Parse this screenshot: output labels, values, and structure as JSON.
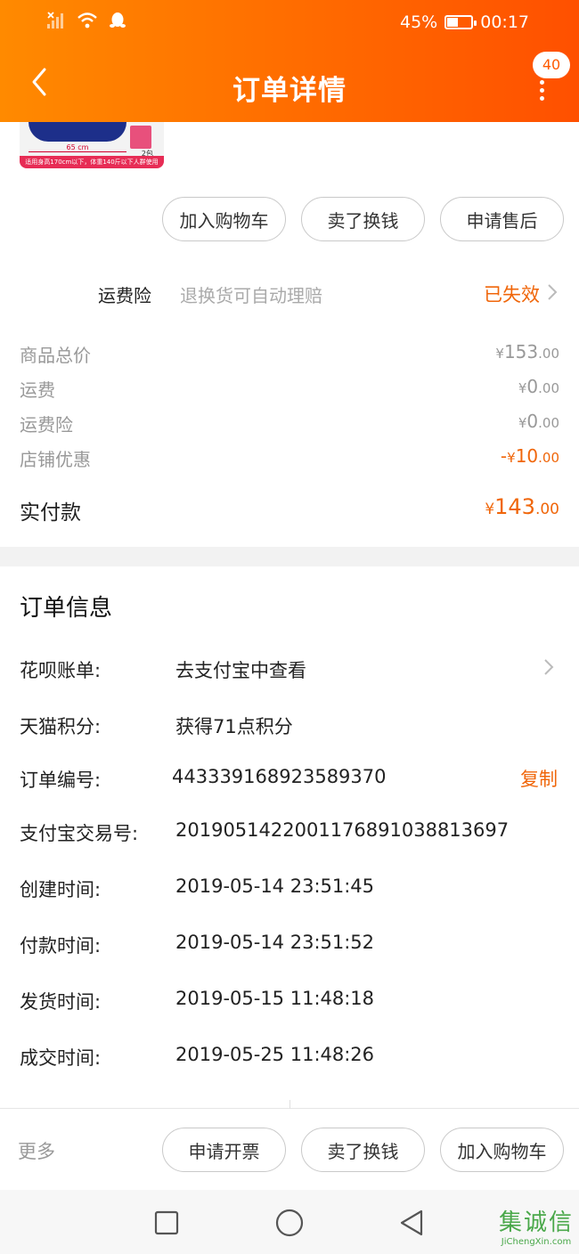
{
  "status_bar": {
    "battery": "45%",
    "battery_level": 0.45,
    "time": "00:17"
  },
  "header": {
    "title": "订单详情",
    "badge": "40"
  },
  "thumbnail": {
    "ruler_text": "65 cm",
    "pack_label": "2包",
    "strip_text": "适用身高170cm以下，体重140斤以下人群使用"
  },
  "item_actions": [
    "加入购物车",
    "卖了换钱",
    "申请售后"
  ],
  "insurance": {
    "label": "运费险",
    "desc": "退换货可自动理赔",
    "status": "已失效"
  },
  "price_rows": [
    {
      "label": "商品总价",
      "sign": "",
      "int": "153",
      "dec": ".00"
    },
    {
      "label": "运费",
      "sign": "",
      "int": "0",
      "dec": ".00"
    },
    {
      "label": "运费险",
      "sign": "",
      "int": "0",
      "dec": ".00"
    },
    {
      "label": "店铺优惠",
      "sign": "-",
      "int": "10",
      "dec": ".00"
    }
  ],
  "currency_symbol": "¥",
  "total": {
    "label": "实付款",
    "int": "143",
    "dec": ".00"
  },
  "order_info": {
    "title": "订单信息",
    "rows": [
      {
        "label": "花呗账单:",
        "value": "去支付宝中查看"
      },
      {
        "label": "天猫积分:",
        "value": "获得71点积分"
      },
      {
        "label": "订单编号:",
        "value": "443339168923589370",
        "action": "复制"
      },
      {
        "label": "支付宝交易号:",
        "value": "2019051422001176891038813697"
      },
      {
        "label": "创建时间:",
        "value": "2019-05-14 23:51:45"
      },
      {
        "label": "付款时间:",
        "value": "2019-05-14 23:51:52"
      },
      {
        "label": "发货时间:",
        "value": "2019-05-15 11:48:18"
      },
      {
        "label": "成交时间:",
        "value": "2019-05-25 11:48:26"
      }
    ]
  },
  "bottom_bar": {
    "more": "更多",
    "buttons": [
      "申请开票",
      "卖了换钱",
      "加入购物车"
    ]
  },
  "watermark": {
    "logo": "集诚信",
    "url": "JiChengXin.com"
  },
  "colors": {
    "accent": "#ff6a00",
    "accent_text": "#f0660a",
    "muted": "#999999"
  }
}
